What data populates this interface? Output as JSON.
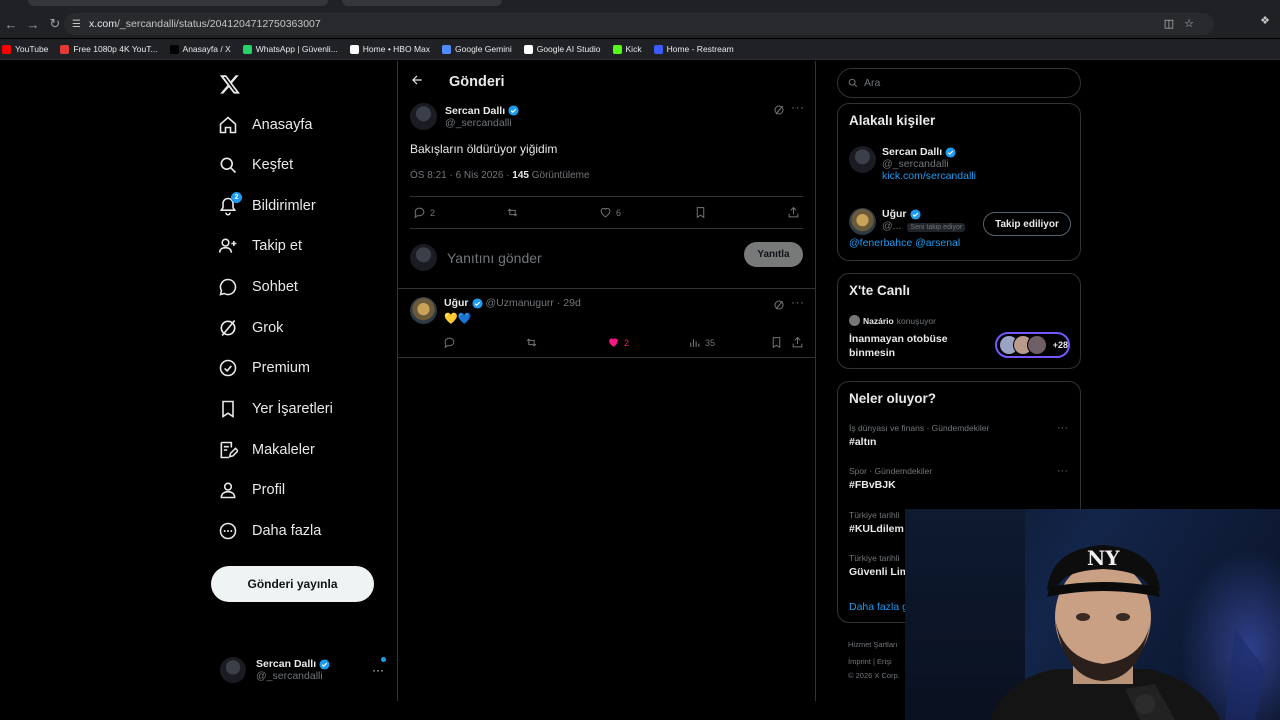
{
  "browser": {
    "url_prefix": "x.com",
    "url_path": "/_sercandalli/status/2041204712750363007",
    "bookmarks": [
      {
        "label": "YouTube",
        "icon": "youtube-icon",
        "color": "#ff0000"
      },
      {
        "label": "Free 1080p 4K YouT...",
        "icon": "download-icon",
        "color": "#e53935"
      },
      {
        "label": "Anasayfa / X",
        "icon": "x-icon",
        "color": "#000000"
      },
      {
        "label": "WhatsApp | Güvenli...",
        "icon": "whatsapp-icon",
        "color": "#25d366"
      },
      {
        "label": "Home • HBO Max",
        "icon": "hbo-icon",
        "color": "#ffffff"
      },
      {
        "label": "Google Gemini",
        "icon": "gemini-icon",
        "color": "#4f8cff"
      },
      {
        "label": "Google AI Studio",
        "icon": "ai-studio-icon",
        "color": "#ffffff"
      },
      {
        "label": "Kick",
        "icon": "kick-icon",
        "color": "#53fc18"
      },
      {
        "label": "Home - Restream",
        "icon": "restream-icon",
        "color": "#3b5bfd"
      }
    ]
  },
  "nav": {
    "items": [
      {
        "label": "Anasayfa",
        "icon": "home-icon"
      },
      {
        "label": "Keşfet",
        "icon": "search-icon"
      },
      {
        "label": "Bildirimler",
        "icon": "bell-icon",
        "badge": "2"
      },
      {
        "label": "Takip et",
        "icon": "follow-icon"
      },
      {
        "label": "Sohbet",
        "icon": "chat-icon"
      },
      {
        "label": "Grok",
        "icon": "grok-icon"
      },
      {
        "label": "Premium",
        "icon": "premium-icon"
      },
      {
        "label": "Yer İşaretleri",
        "icon": "bookmark-icon"
      },
      {
        "label": "Makaleler",
        "icon": "articles-icon"
      },
      {
        "label": "Profil",
        "icon": "profile-icon"
      },
      {
        "label": "Daha fazla",
        "icon": "more-circle-icon"
      }
    ],
    "post_button": "Gönderi yayınla",
    "account": {
      "name": "Sercan Dallı",
      "handle": "@_sercandalli"
    }
  },
  "post": {
    "header_title": "Gönderi",
    "author_name": "Sercan Dallı",
    "author_handle": "@_sercandalli",
    "text": "Bakışların öldürüyor yiğidim",
    "time": "ÖS 8:21 · 6 Nis 2026 · ",
    "views_count": "145",
    "views_label": " Görüntüleme",
    "replies": "2",
    "likes": "6",
    "reply_placeholder": "Yanıtını gönder",
    "reply_button": "Yanıtla"
  },
  "reply": {
    "name": "Uğur",
    "handle": "@Uzmanugurr · 29d",
    "text": "💛💙",
    "likes": "2",
    "views": "35"
  },
  "sidebar": {
    "search_placeholder": "Ara",
    "related_title": "Alakalı kişiler",
    "person1": {
      "name": "Sercan Dallı",
      "handle": "@_sercandalli",
      "link": "kick.com/sercandalli"
    },
    "person2": {
      "name": "Uğur",
      "handle": "@...",
      "follows_you": "Seni takip ediyor",
      "button": "Takip ediliyor",
      "bio": "@fenerbahce @arsenal"
    },
    "live_title": "X'te Canlı",
    "live_host": "Nazário",
    "live_status": "konuşuyor",
    "live_space_line1": "İnanmayan otobüse",
    "live_space_line2": "binmesin",
    "live_count": "+28",
    "trends_title": "Neler oluyor?",
    "trends": [
      {
        "category": "İş dünyası ve finans · Gündemdekiler",
        "name": "#altın"
      },
      {
        "category": "Spor · Gündemdekiler",
        "name": "#FBvBJK"
      },
      {
        "category": "Türkiye tarihli",
        "name": "#KULdilem"
      },
      {
        "category": "Türkiye tarihli",
        "name": "Güvenli Lim"
      }
    ],
    "show_more": "Daha fazla g",
    "footer_line1": "Hizmet Şartları",
    "footer_line2": "İmprint  |  Erişi",
    "footer_line3": "© 2026 X Corp."
  }
}
